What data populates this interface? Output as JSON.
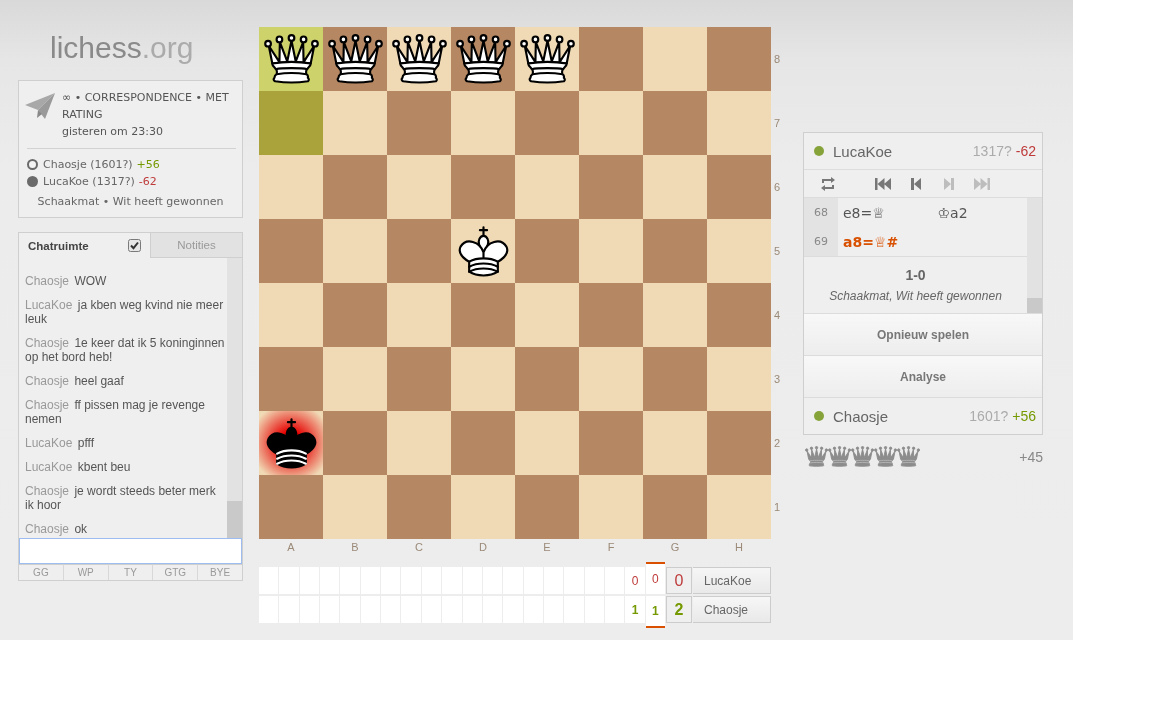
{
  "logo": {
    "name": "lichess",
    "suffix": ".org"
  },
  "game_info": {
    "type": "∞ • CORRESPONDENCE • MET RATING",
    "date": "gisteren om 23:30",
    "players": [
      {
        "black": false,
        "name": "Chaosje (1601?)",
        "diff": "+56",
        "color": "#759900"
      },
      {
        "black": true,
        "name": "LucaKoe (1317?)",
        "diff": "-62",
        "color": "#bf3b3b"
      }
    ],
    "status": "Schaakmat • Wit heeft gewonnen"
  },
  "chat": {
    "tabs": [
      {
        "label": "Chatruimte",
        "selected": true
      },
      {
        "label": "Notities",
        "selected": false
      }
    ],
    "toggle": {
      "checked": true
    },
    "messages": [
      {
        "user": "Chaosje",
        "text": "WOW"
      },
      {
        "user": "LucaKoe",
        "text": "ja kben weg kvind nie meer leuk"
      },
      {
        "user": "Chaosje",
        "text": "1e keer dat ik 5 koninginnen op het bord heb!"
      },
      {
        "user": "Chaosje",
        "text": "heel gaaf"
      },
      {
        "user": "Chaosje",
        "text": "ff pissen mag je revenge nemen"
      },
      {
        "user": "LucaKoe",
        "text": "pfff"
      },
      {
        "user": "LucaKoe",
        "text": "kbent beu"
      },
      {
        "user": "Chaosje",
        "text": "je wordt steeds beter merk ik hoor"
      },
      {
        "user": "Chaosje",
        "text": "ok"
      }
    ],
    "presets": [
      "GG",
      "WP",
      "TY",
      "GTG",
      "BYE"
    ]
  },
  "board": {
    "rows": [
      {
        "label": "8",
        "squares": [
          {
            "kind": "queen",
            "black": false,
            "last_move": true,
            "check": false
          },
          {
            "kind": "queen",
            "black": false,
            "last_move": false,
            "check": false
          },
          {
            "kind": "queen",
            "black": false,
            "last_move": false,
            "check": false
          },
          {
            "kind": "queen",
            "black": false,
            "last_move": false,
            "check": false
          },
          {
            "kind": "queen",
            "black": false,
            "last_move": false,
            "check": false
          },
          {
            "kind": "empty",
            "last_move": false,
            "check": false
          },
          {
            "kind": "empty",
            "last_move": false,
            "check": false
          },
          {
            "kind": "empty",
            "last_move": false,
            "check": false
          }
        ]
      },
      {
        "label": "7",
        "squares": [
          {
            "kind": "empty",
            "last_move": true,
            "check": false
          },
          {
            "kind": "empty",
            "last_move": false,
            "check": false
          },
          {
            "kind": "empty",
            "last_move": false,
            "check": false
          },
          {
            "kind": "empty",
            "last_move": false,
            "check": false
          },
          {
            "kind": "empty",
            "last_move": false,
            "check": false
          },
          {
            "kind": "empty",
            "last_move": false,
            "check": false
          },
          {
            "kind": "empty",
            "last_move": false,
            "check": false
          },
          {
            "kind": "empty",
            "last_move": false,
            "check": false
          }
        ]
      },
      {
        "label": "6",
        "squares": [
          {
            "kind": "empty",
            "last_move": false,
            "check": false
          },
          {
            "kind": "empty",
            "last_move": false,
            "check": false
          },
          {
            "kind": "empty",
            "last_move": false,
            "check": false
          },
          {
            "kind": "empty",
            "last_move": false,
            "check": false
          },
          {
            "kind": "empty",
            "last_move": false,
            "check": false
          },
          {
            "kind": "empty",
            "last_move": false,
            "check": false
          },
          {
            "kind": "empty",
            "last_move": false,
            "check": false
          },
          {
            "kind": "empty",
            "last_move": false,
            "check": false
          }
        ]
      },
      {
        "label": "5",
        "squares": [
          {
            "kind": "empty",
            "last_move": false,
            "check": false
          },
          {
            "kind": "empty",
            "last_move": false,
            "check": false
          },
          {
            "kind": "empty",
            "last_move": false,
            "check": false
          },
          {
            "kind": "king",
            "black": false,
            "last_move": false,
            "check": false
          },
          {
            "kind": "empty",
            "last_move": false,
            "check": false
          },
          {
            "kind": "empty",
            "last_move": false,
            "check": false
          },
          {
            "kind": "empty",
            "last_move": false,
            "check": false
          },
          {
            "kind": "empty",
            "last_move": false,
            "check": false
          }
        ]
      },
      {
        "label": "4",
        "squares": [
          {
            "kind": "empty",
            "last_move": false,
            "check": false
          },
          {
            "kind": "empty",
            "last_move": false,
            "check": false
          },
          {
            "kind": "empty",
            "last_move": false,
            "check": false
          },
          {
            "kind": "empty",
            "last_move": false,
            "check": false
          },
          {
            "kind": "empty",
            "last_move": false,
            "check": false
          },
          {
            "kind": "empty",
            "last_move": false,
            "check": false
          },
          {
            "kind": "empty",
            "last_move": false,
            "check": false
          },
          {
            "kind": "empty",
            "last_move": false,
            "check": false
          }
        ]
      },
      {
        "label": "3",
        "squares": [
          {
            "kind": "empty",
            "last_move": false,
            "check": false
          },
          {
            "kind": "empty",
            "last_move": false,
            "check": false
          },
          {
            "kind": "empty",
            "last_move": false,
            "check": false
          },
          {
            "kind": "empty",
            "last_move": false,
            "check": false
          },
          {
            "kind": "empty",
            "last_move": false,
            "check": false
          },
          {
            "kind": "empty",
            "last_move": false,
            "check": false
          },
          {
            "kind": "empty",
            "last_move": false,
            "check": false
          },
          {
            "kind": "empty",
            "last_move": false,
            "check": false
          }
        ]
      },
      {
        "label": "2",
        "squares": [
          {
            "kind": "king",
            "black": true,
            "last_move": false,
            "check": true
          },
          {
            "kind": "empty",
            "last_move": false,
            "check": false
          },
          {
            "kind": "empty",
            "last_move": false,
            "check": false
          },
          {
            "kind": "empty",
            "last_move": false,
            "check": false
          },
          {
            "kind": "empty",
            "last_move": false,
            "check": false
          },
          {
            "kind": "empty",
            "last_move": false,
            "check": false
          },
          {
            "kind": "empty",
            "last_move": false,
            "check": false
          },
          {
            "kind": "empty",
            "last_move": false,
            "check": false
          }
        ]
      },
      {
        "label": "1",
        "squares": [
          {
            "kind": "empty",
            "last_move": false,
            "check": false
          },
          {
            "kind": "empty",
            "last_move": false,
            "check": false
          },
          {
            "kind": "empty",
            "last_move": false,
            "check": false
          },
          {
            "kind": "empty",
            "last_move": false,
            "check": false
          },
          {
            "kind": "empty",
            "last_move": false,
            "check": false
          },
          {
            "kind": "empty",
            "last_move": false,
            "check": false
          },
          {
            "kind": "empty",
            "last_move": false,
            "check": false
          },
          {
            "kind": "empty",
            "last_move": false,
            "check": false
          }
        ]
      }
    ],
    "files": [
      "A",
      "B",
      "C",
      "D",
      "E",
      "F",
      "G",
      "H"
    ]
  },
  "crosstable": {
    "rows": [
      {
        "player": "LucaKoe",
        "total": "0",
        "won": false,
        "results": [
          {
            "score": "0",
            "won": false,
            "current": false
          },
          {
            "score": "0",
            "won": false,
            "current": true
          }
        ]
      },
      {
        "player": "Chaosje",
        "total": "2",
        "won": true,
        "results": [
          {
            "score": "1",
            "won": true,
            "current": false
          },
          {
            "score": "1",
            "won": true,
            "current": true
          }
        ]
      }
    ]
  },
  "game_panel": {
    "top_player": {
      "name": "LucaKoe",
      "rating": "1317?",
      "diff": "-62",
      "color": "#bf3b3b",
      "online": true
    },
    "controls": [
      {
        "kind": "flip",
        "disabled": false
      },
      {
        "kind": "first",
        "disabled": false
      },
      {
        "kind": "prev",
        "disabled": false
      },
      {
        "kind": "next",
        "disabled": true
      },
      {
        "kind": "last",
        "disabled": true
      }
    ],
    "moves": [
      {
        "number": "68",
        "white": {
          "san": "e8=♕",
          "active": false
        },
        "black": {
          "san": "♔a2",
          "active": false
        }
      },
      {
        "number": "69",
        "white": {
          "san": "a8=♕#",
          "active": true
        }
      }
    ],
    "result": {
      "score": "1-0",
      "text": "Schaakmat, Wit heeft gewonnen"
    },
    "buttons": [
      "Opnieuw spelen",
      "Analyse"
    ],
    "bottom_player": {
      "name": "Chaosje",
      "rating": "1601?",
      "diff": "+56",
      "color": "#759900",
      "online": true
    }
  },
  "material": {
    "pieces": [
      {
        "kind": "queen"
      },
      {
        "kind": "queen"
      },
      {
        "kind": "queen"
      },
      {
        "kind": "queen"
      },
      {
        "kind": "queen"
      }
    ],
    "advantage": "+45"
  }
}
